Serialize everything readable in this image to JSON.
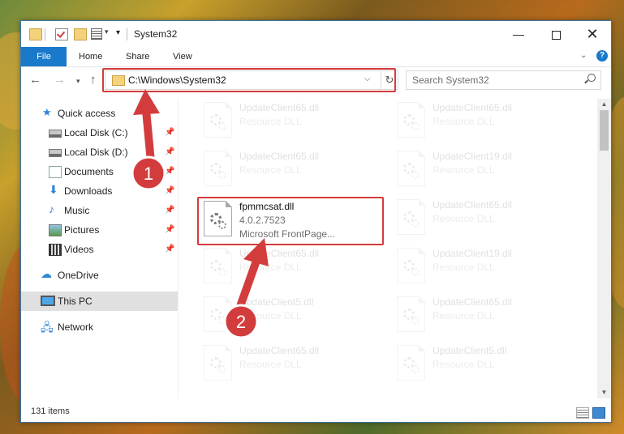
{
  "window": {
    "title": "System32",
    "minimize": "—",
    "close": "✕"
  },
  "ribbon": {
    "tabs": [
      "File",
      "Home",
      "Share",
      "View"
    ],
    "help": "?"
  },
  "address": {
    "path": "C:\\Windows\\System32",
    "search_placeholder": "Search System32"
  },
  "sidebar": {
    "items": [
      {
        "label": "Quick access",
        "icon": "star-icon",
        "pinned": false
      },
      {
        "label": "Local Disk (C:)",
        "icon": "disk-icon",
        "pinned": true
      },
      {
        "label": "Local Disk (D:)",
        "icon": "disk-icon",
        "pinned": true
      },
      {
        "label": "Documents",
        "icon": "documents-icon",
        "pinned": true
      },
      {
        "label": "Downloads",
        "icon": "download-icon",
        "pinned": true
      },
      {
        "label": "Music",
        "icon": "music-icon",
        "pinned": true
      },
      {
        "label": "Pictures",
        "icon": "pictures-icon",
        "pinned": true
      },
      {
        "label": "Videos",
        "icon": "videos-icon",
        "pinned": true
      },
      {
        "label": "OneDrive",
        "icon": "cloud-icon",
        "pinned": false
      },
      {
        "label": "This PC",
        "icon": "computer-icon",
        "pinned": false,
        "selected": true
      },
      {
        "label": "Network",
        "icon": "network-icon",
        "pinned": false
      }
    ]
  },
  "files": {
    "left": [
      {
        "name": "UpdateClient65.dll",
        "type": "Resource DLL"
      },
      {
        "name": "UpdateClient65.dll",
        "type": "Resource DLL"
      },
      {
        "name": "fpmmcsat.dll",
        "version": "4.0.2.7523",
        "desc": "Microsoft FrontPage..."
      },
      {
        "name": "UpdateClient65.dll",
        "type": "Resource DLL"
      },
      {
        "name": "UpdateClient5.dll",
        "type": "Resource DLL"
      },
      {
        "name": "UpdateClient65.dll",
        "type": "Resource DLL"
      }
    ],
    "right": [
      {
        "name": "UpdateClient65.dll",
        "type": "Resource DLL"
      },
      {
        "name": "UpdateClient19.dll",
        "type": "Resource DLL"
      },
      {
        "name": "UpdateClient65.dll",
        "type": "Resource DLL"
      },
      {
        "name": "UpdateClient19.dll",
        "type": "Resource DLL"
      },
      {
        "name": "UpdateClient65.dll",
        "type": "Resource DLL"
      },
      {
        "name": "UpdateClient5.dll",
        "type": "Resource DLL"
      }
    ]
  },
  "status": {
    "item_count": "131 items"
  },
  "annotations": {
    "step1": "1",
    "step2": "2",
    "color": "#d33c3c"
  }
}
